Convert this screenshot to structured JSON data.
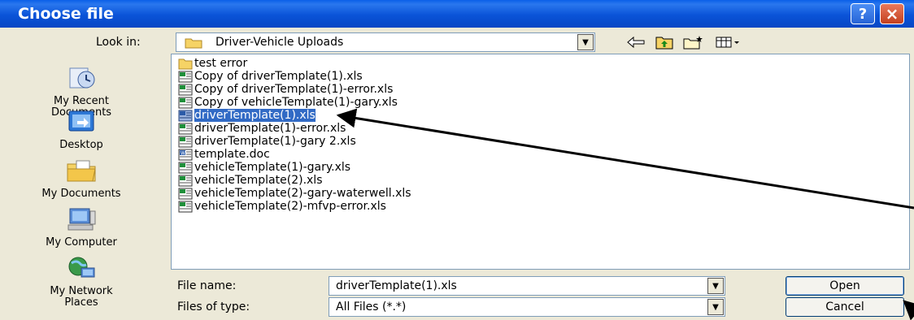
{
  "window": {
    "title": "Choose file",
    "help_label": "?",
    "close_label": "×"
  },
  "lookin": {
    "label": "Look in:",
    "value": "Driver-Vehicle Uploads"
  },
  "places": [
    {
      "label1": "My Recent",
      "label2": "Documents",
      "icon": "recent-documents-icon"
    },
    {
      "label1": "Desktop",
      "label2": "",
      "icon": "desktop-icon"
    },
    {
      "label1": "My Documents",
      "label2": "",
      "icon": "my-documents-icon"
    },
    {
      "label1": "My Computer",
      "label2": "",
      "icon": "my-computer-icon"
    },
    {
      "label1": "My Network",
      "label2": "Places",
      "icon": "network-places-icon"
    }
  ],
  "files": [
    {
      "name": "test error",
      "type": "folder"
    },
    {
      "name": "Copy of driverTemplate(1).xls",
      "type": "xls"
    },
    {
      "name": "Copy of driverTemplate(1)-error.xls",
      "type": "xls"
    },
    {
      "name": "Copy of vehicleTemplate(1)-gary.xls",
      "type": "xls"
    },
    {
      "name": "driverTemplate(1).xls",
      "type": "xls",
      "selected": true
    },
    {
      "name": "driverTemplate(1)-error.xls",
      "type": "xls"
    },
    {
      "name": "driverTemplate(1)-gary 2.xls",
      "type": "xls"
    },
    {
      "name": "template.doc",
      "type": "doc"
    },
    {
      "name": "vehicleTemplate(1)-gary.xls",
      "type": "xls"
    },
    {
      "name": "vehicleTemplate(2).xls",
      "type": "xls"
    },
    {
      "name": "vehicleTemplate(2)-gary-waterwell.xls",
      "type": "xls"
    },
    {
      "name": "vehicleTemplate(2)-mfvp-error.xls",
      "type": "xls"
    }
  ],
  "filename": {
    "label": "File name:",
    "value": "driverTemplate(1).xls"
  },
  "filetype": {
    "label": "Files of type:",
    "value": "All Files (*.*)"
  },
  "buttons": {
    "open": "Open",
    "cancel": "Cancel"
  },
  "colors": {
    "titlebar": "#0a53d8",
    "selection": "#316ac5",
    "dialog_bg": "#ece9d8"
  }
}
